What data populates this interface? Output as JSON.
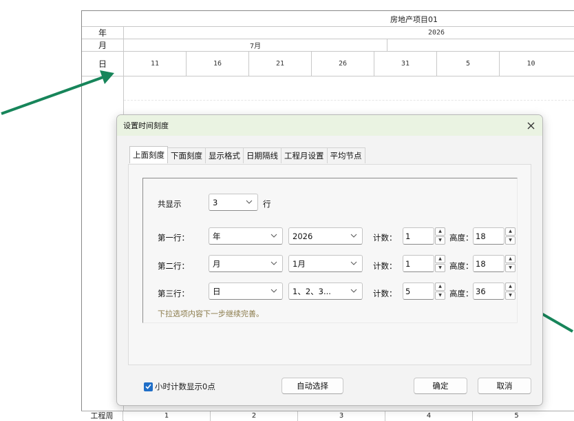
{
  "gantt": {
    "project_title": "房地产项目01",
    "year_label": "年",
    "month_label": "月",
    "day_label": "日",
    "year_value": "2026",
    "month_value": "7月",
    "days": [
      "11",
      "16",
      "21",
      "26",
      "31",
      "5",
      "10"
    ],
    "week_label": "工程周",
    "weeks": [
      "1",
      "2",
      "3",
      "4",
      "5"
    ]
  },
  "dialog": {
    "title": "设置时间刻度",
    "tabs": [
      "上面刻度",
      "下面刻度",
      "显示格式",
      "日期隔线",
      "工程月设置",
      "平均节点"
    ],
    "active_tab": 0,
    "show_rows_label": "共显示",
    "show_rows_value": "3",
    "show_rows_unit": "行",
    "rows": [
      {
        "label": "第一行：",
        "unit": "年",
        "value": "2026",
        "count_label": "计数：",
        "count": "1",
        "height_label": "高度：",
        "height": "18"
      },
      {
        "label": "第二行：",
        "unit": "月",
        "value": "1月",
        "count_label": "计数：",
        "count": "1",
        "height_label": "高度：",
        "height": "18"
      },
      {
        "label": "第三行：",
        "unit": "日",
        "value": "1、2、3...",
        "count_label": "计数：",
        "count": "5",
        "height_label": "高度：",
        "height": "36"
      }
    ],
    "hint": "下拉选项内容下一步继续完善。",
    "checkbox_label": "小时计数显示0点",
    "checkbox_checked": true,
    "auto_select_label": "自动选择",
    "ok_label": "确定",
    "cancel_label": "取消"
  },
  "colors": {
    "arrow": "#17855a",
    "title_bg": "#eaf3e2",
    "checkbox": "#1f6ec7"
  }
}
